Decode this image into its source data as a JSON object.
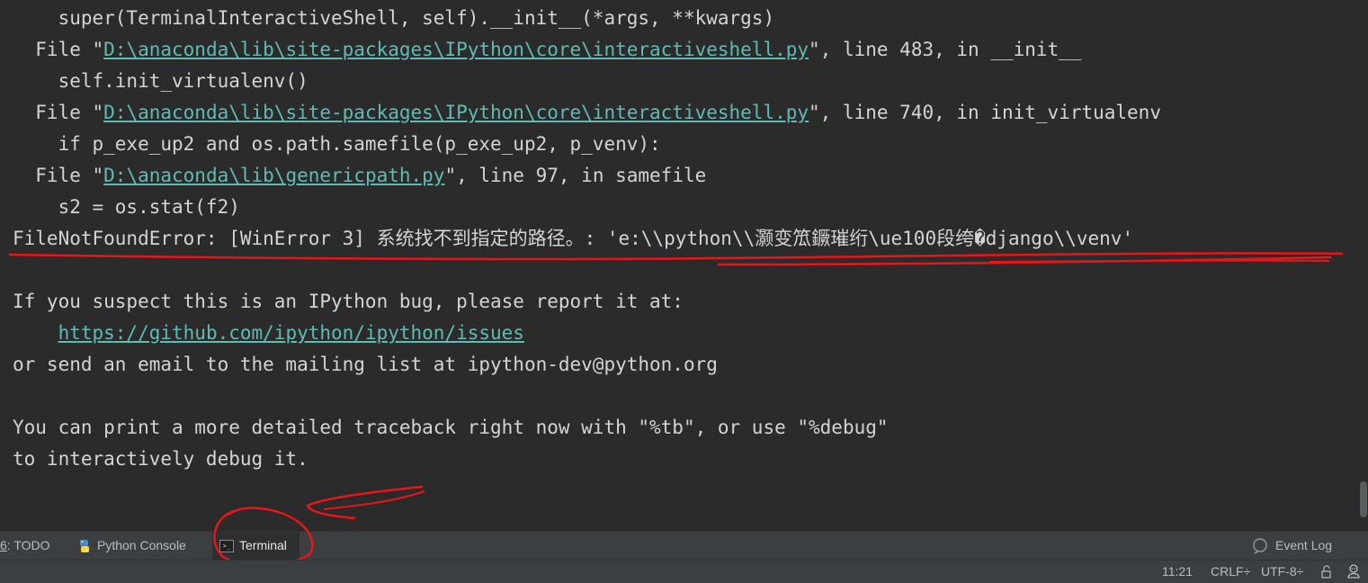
{
  "terminal": {
    "lines": [
      {
        "segments": [
          {
            "text": "    super(TerminalInteractiveShell, self).__init__(*args, **kwargs)"
          }
        ]
      },
      {
        "segments": [
          {
            "text": "  File \""
          },
          {
            "text": "D:\\anaconda\\lib\\site-packages\\IPython\\core\\interactiveshell.py",
            "link": true
          },
          {
            "text": "\", line 483, in __init__"
          }
        ]
      },
      {
        "segments": [
          {
            "text": "    self.init_virtualenv()"
          }
        ]
      },
      {
        "segments": [
          {
            "text": "  File \""
          },
          {
            "text": "D:\\anaconda\\lib\\site-packages\\IPython\\core\\interactiveshell.py",
            "link": true
          },
          {
            "text": "\", line 740, in init_virtualenv"
          }
        ]
      },
      {
        "segments": [
          {
            "text": "    if p_exe_up2 and os.path.samefile(p_exe_up2, p_venv):"
          }
        ]
      },
      {
        "segments": [
          {
            "text": "  File \""
          },
          {
            "text": "D:\\anaconda\\lib\\genericpath.py",
            "link": true
          },
          {
            "text": "\", line 97, in samefile"
          }
        ]
      },
      {
        "segments": [
          {
            "text": "    s2 = os.stat(f2)"
          }
        ]
      },
      {
        "segments": [
          {
            "text": "FileNotFoundError: [WinError 3] 系统找不到指定的路径。: 'e:\\\\python\\\\灏变笟鐝璀绗\\ue100段绔�django\\\\venv'"
          }
        ]
      },
      {
        "segments": [
          {
            "text": ""
          }
        ]
      },
      {
        "segments": [
          {
            "text": "If you suspect this is an IPython bug, please report it at:"
          }
        ]
      },
      {
        "segments": [
          {
            "text": "    "
          },
          {
            "text": "https://github.com/ipython/ipython/issues",
            "link": true
          }
        ]
      },
      {
        "segments": [
          {
            "text": "or send an email to the mailing list at ipython-dev@python.org"
          }
        ]
      },
      {
        "segments": [
          {
            "text": ""
          }
        ]
      },
      {
        "segments": [
          {
            "text": "You can print a more detailed traceback right now with \"%tb\", or use \"%debug\""
          }
        ]
      },
      {
        "segments": [
          {
            "text": "to interactively debug it."
          }
        ]
      }
    ]
  },
  "toolwindows": {
    "todo_mnemonic": "6",
    "todo_label": ": TODO",
    "python_console_label": "Python Console",
    "terminal_label": "Terminal",
    "event_log_label": "Event Log"
  },
  "statusbar": {
    "position": "11:21",
    "line_separator": "CRLF",
    "encoding": "UTF-8",
    "dropdown_glyph": "÷"
  },
  "colors": {
    "background": "#2b2b2b",
    "text": "#d4d4d4",
    "link": "#5fbcb4",
    "annotation_red": "#e8151b"
  }
}
